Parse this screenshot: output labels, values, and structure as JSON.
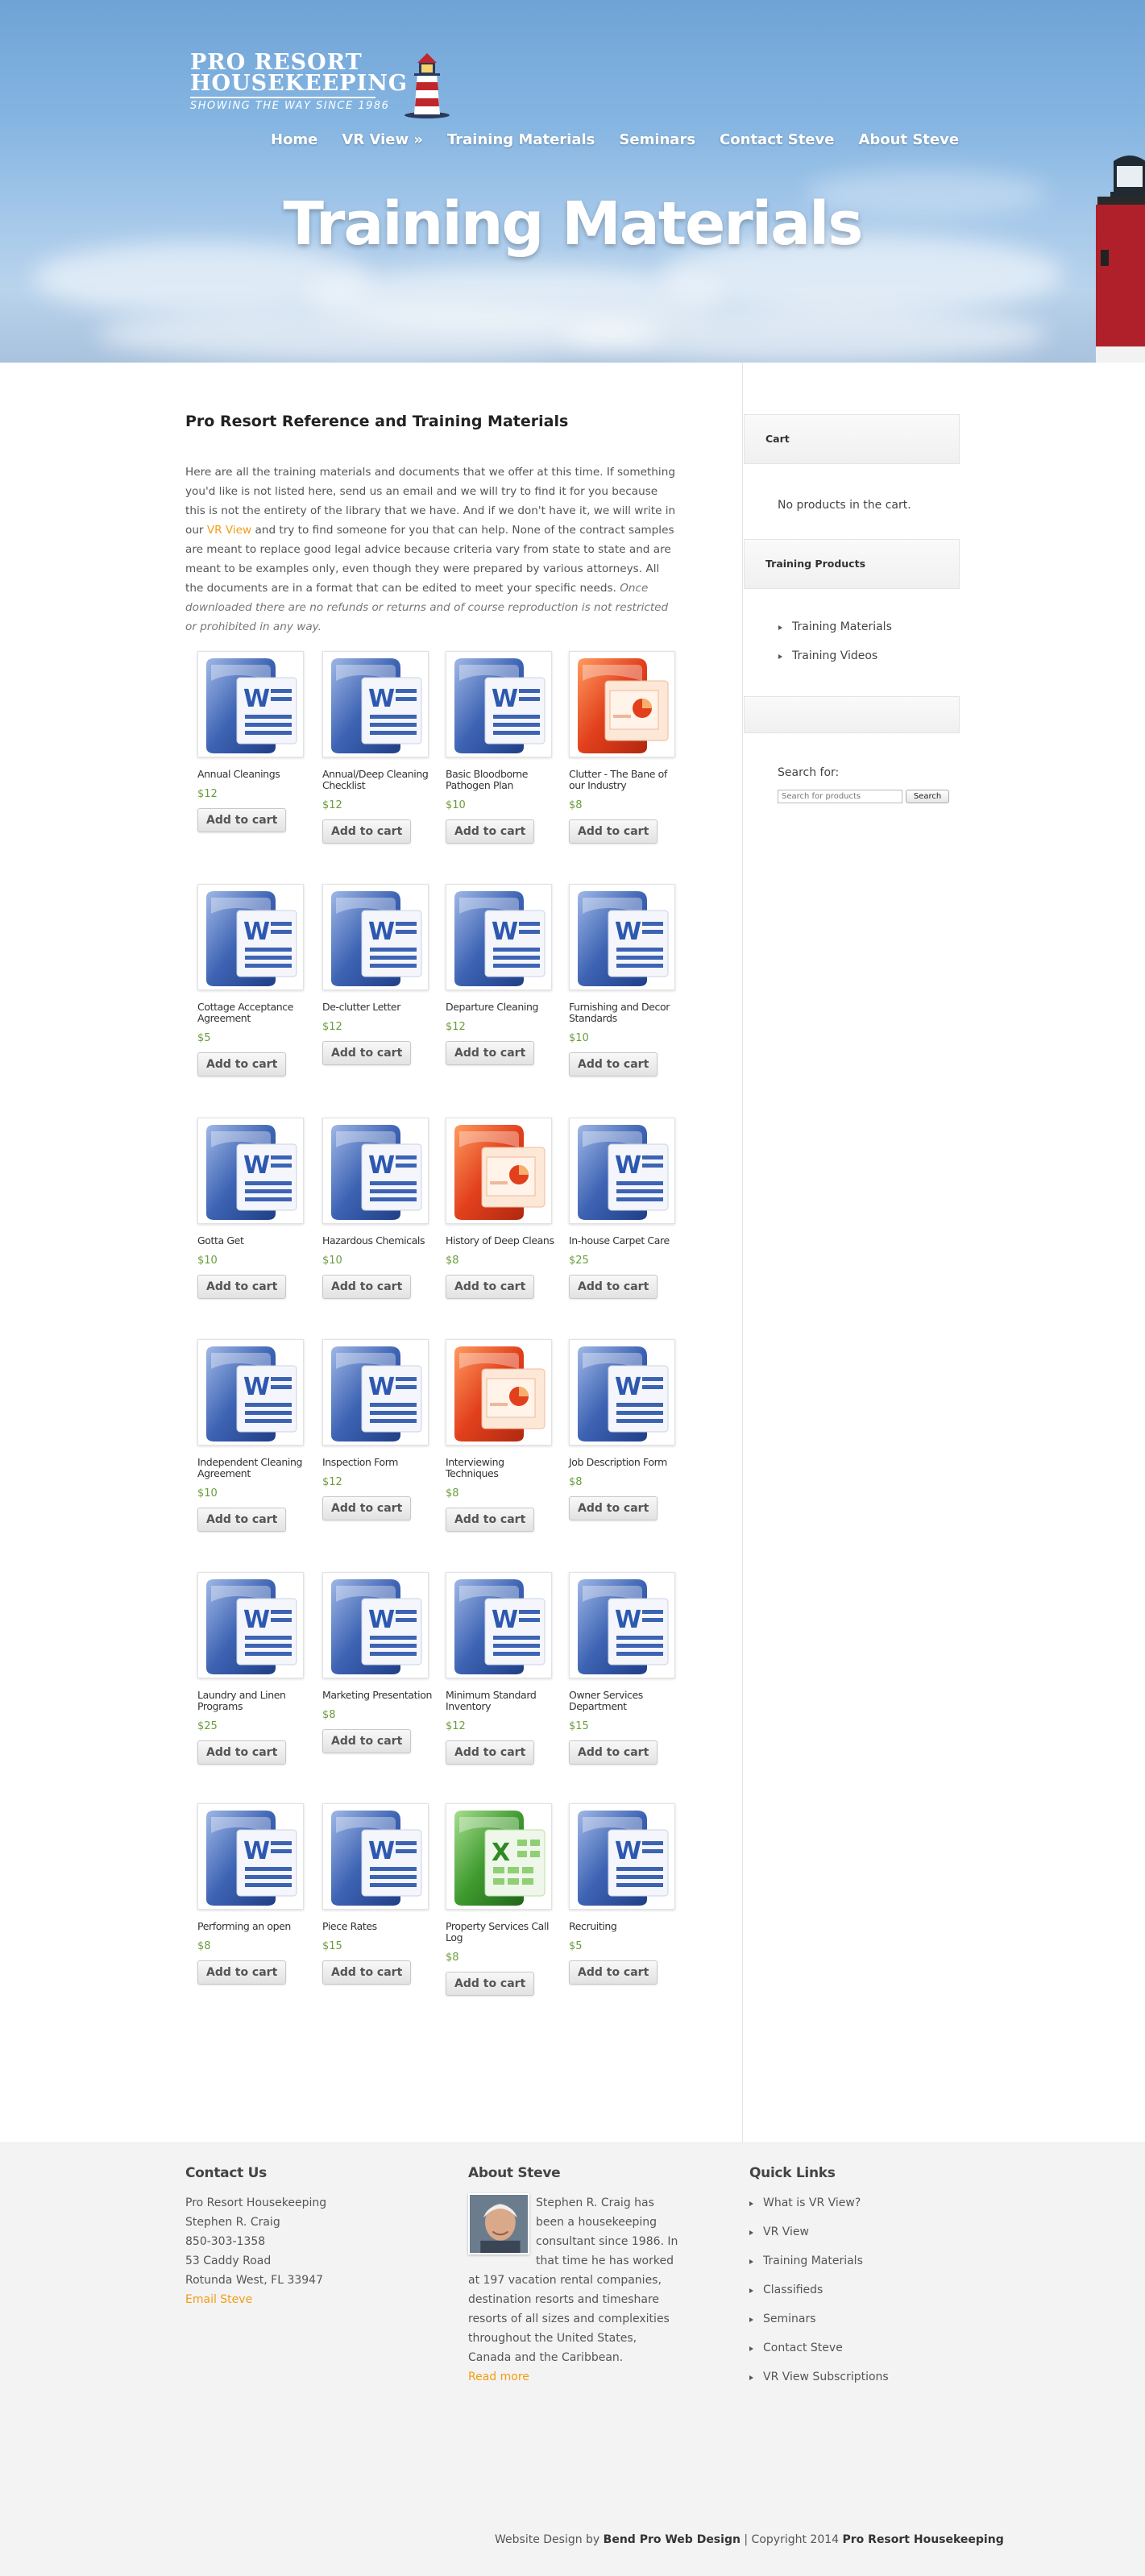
{
  "site": {
    "logo_line1": "PRO RESORT",
    "logo_line2": "HOUSEKEEPING",
    "logo_tagline": "SHOWING THE WAY SINCE 1986"
  },
  "nav": [
    "Home",
    "VR View »",
    "Training Materials",
    "Seminars",
    "Contact Steve",
    "About Steve"
  ],
  "hero_title": "Training Materials",
  "content": {
    "heading": "Pro Resort Reference and Training Materials",
    "intro_part1": "Here are all the training materials and documents that we offer at this time. If something you'd like is not listed here, send us an email and we will try to find it for you because this is not the entirety of the library that we have. And if we don't have it, we will write in our ",
    "intro_link": "VR View",
    "intro_part2": " and try to find someone for you that can help. None of the contract samples are meant to replace good legal advice because criteria vary from state to state and are meant to be examples only, even though they were prepared by various attorneys. All the documents are in a format that can be edited to meet your specific needs. ",
    "intro_italic": "Once downloaded there are no refunds or returns and of course reproduction is not restricted or prohibited in any way."
  },
  "add_to_cart_label": "Add to cart",
  "products": [
    {
      "name": "Annual Cleanings",
      "price": "$12",
      "icon": "word-icon"
    },
    {
      "name": "Annual/Deep Cleaning Checklist",
      "price": "$12",
      "icon": "word-icon"
    },
    {
      "name": "Basic Bloodborne Pathogen Plan",
      "price": "$10",
      "icon": "word-icon"
    },
    {
      "name": "Clutter - The Bane of our Industry",
      "price": "$8",
      "icon": "powerpoint-icon"
    },
    {
      "name": "Cottage Acceptance Agreement",
      "price": "$5",
      "icon": "word-icon"
    },
    {
      "name": "De-clutter Letter",
      "price": "$12",
      "icon": "word-icon"
    },
    {
      "name": "Departure Cleaning",
      "price": "$12",
      "icon": "word-icon"
    },
    {
      "name": "Furnishing and Decor Standards",
      "price": "$10",
      "icon": "word-icon"
    },
    {
      "name": "Gotta Get",
      "price": "$10",
      "icon": "word-icon"
    },
    {
      "name": "Hazardous Chemicals",
      "price": "$10",
      "icon": "word-icon"
    },
    {
      "name": "History of Deep Cleans",
      "price": "$8",
      "icon": "powerpoint-icon"
    },
    {
      "name": "In-house Carpet Care",
      "price": "$25",
      "icon": "word-icon"
    },
    {
      "name": "Independent Cleaning Agreement",
      "price": "$10",
      "icon": "word-icon"
    },
    {
      "name": "Inspection Form",
      "price": "$12",
      "icon": "word-icon"
    },
    {
      "name": "Interviewing Techniques",
      "price": "$8",
      "icon": "powerpoint-icon"
    },
    {
      "name": "Job Description Form",
      "price": "$8",
      "icon": "word-icon"
    },
    {
      "name": "Laundry and Linen Programs",
      "price": "$25",
      "icon": "word-icon"
    },
    {
      "name": "Marketing Presentation",
      "price": "$8",
      "icon": "word-icon"
    },
    {
      "name": "Minimum Standard Inventory",
      "price": "$12",
      "icon": "word-icon"
    },
    {
      "name": "Owner Services Department",
      "price": "$15",
      "icon": "word-icon"
    },
    {
      "name": "Performing an open",
      "price": "$8",
      "icon": "word-icon"
    },
    {
      "name": "Piece Rates",
      "price": "$15",
      "icon": "word-icon"
    },
    {
      "name": "Property Services Call Log",
      "price": "$8",
      "icon": "excel-icon"
    },
    {
      "name": "Recruiting",
      "price": "$5",
      "icon": "word-icon"
    }
  ],
  "sidebar": {
    "cart_title": "Cart",
    "cart_empty": "No products in the cart.",
    "products_title": "Training Products",
    "product_links": [
      "Training Materials",
      "Training Videos"
    ],
    "search_label": "Search for:",
    "search_placeholder": "Search for products",
    "search_button": "Search"
  },
  "footer": {
    "contact_title": "Contact Us",
    "contact_lines": [
      "Pro Resort Housekeeping",
      "Stephen R. Craig",
      "850-303-1358",
      "53 Caddy Road",
      "Rotunda West, FL 33947"
    ],
    "email_link": "Email Steve",
    "about_title": "About Steve",
    "about_text": "Stephen R. Craig has been a housekeeping consultant since 1986. In that time he has worked at 197 vacation rental companies, destination resorts and timeshare resorts of all sizes and complexities throughout the United States, Canada and the Caribbean.",
    "read_more": "Read more",
    "quick_title": "Quick Links",
    "quick_links": [
      "What is VR View?",
      "VR View",
      "Training Materials",
      "Classifieds",
      "Seminars",
      "Contact Steve",
      "VR View Subscriptions"
    ],
    "credits_prefix": "Website Design by ",
    "credits_designer": "Bend Pro Web Design",
    "credits_middle": " | Copyright 2014 ",
    "credits_owner": "Pro Resort Housekeeping"
  },
  "colors": {
    "link": "#f39c12",
    "price": "#6a9d3c",
    "word_blue": "#3a5fb0",
    "powerpoint_red": "#e2401c",
    "excel_green": "#3f9a2f"
  }
}
